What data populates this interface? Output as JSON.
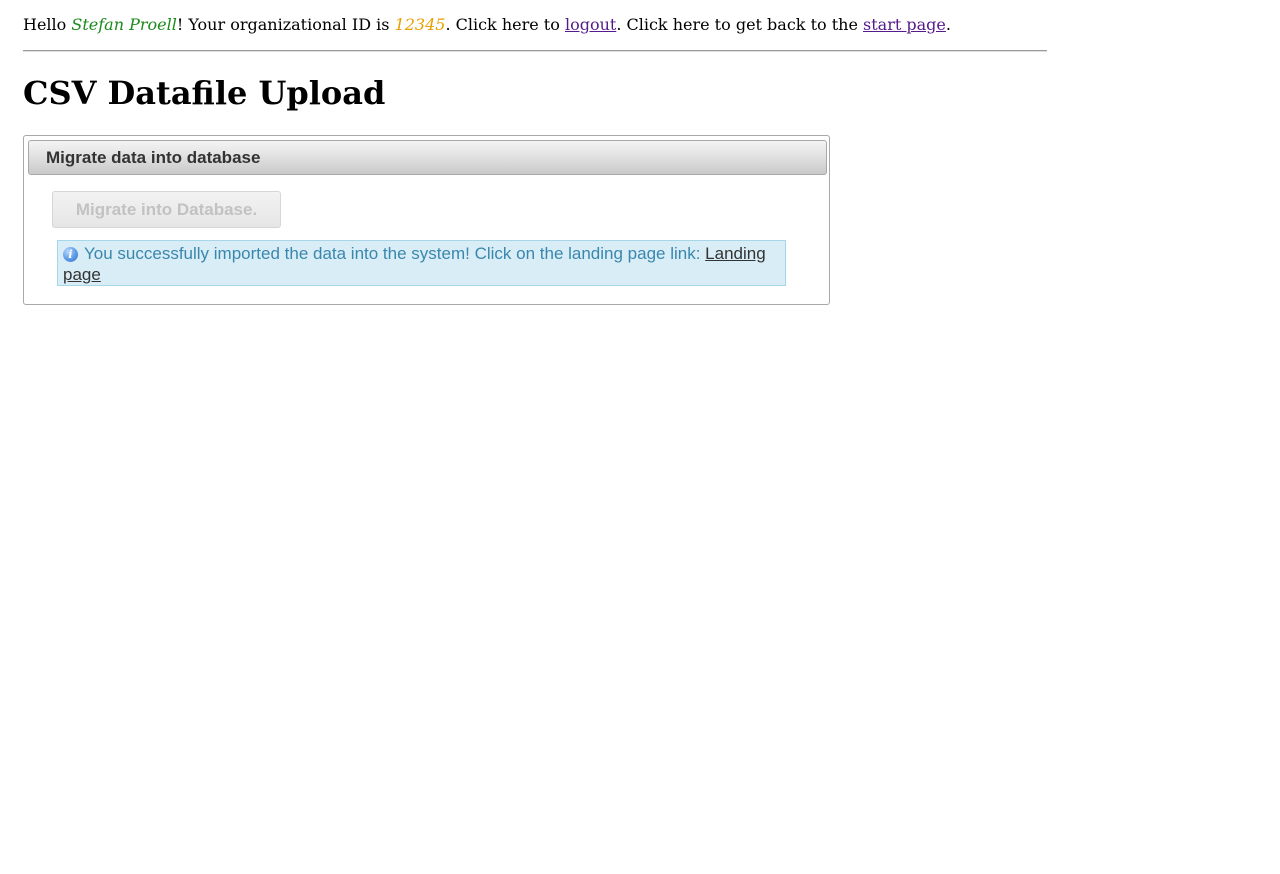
{
  "header": {
    "greeting_prefix": "Hello ",
    "user_name": "Stefan Proell",
    "org_id_prefix": "! Your organizational ID is ",
    "org_id": "12345",
    "logout_prefix": ". Click here to ",
    "logout_label": "logout",
    "start_prefix": ". Click here to get back to the ",
    "start_page_label": "start page",
    "suffix": "."
  },
  "page": {
    "title": "CSV Datafile Upload"
  },
  "panel": {
    "header": "Migrate data into database",
    "button_label": "Migrate into Database.",
    "message_text": "You successfully imported the data into the system! Click on the landing page link: ",
    "message_link": "Landing page",
    "message_icon": "info-icon"
  },
  "colors": {
    "user_name": "#1a8a1a",
    "org_id": "#e8a000",
    "link_visited": "#551a8b",
    "info_text": "#3a87ad",
    "info_background": "#d9edf7"
  }
}
